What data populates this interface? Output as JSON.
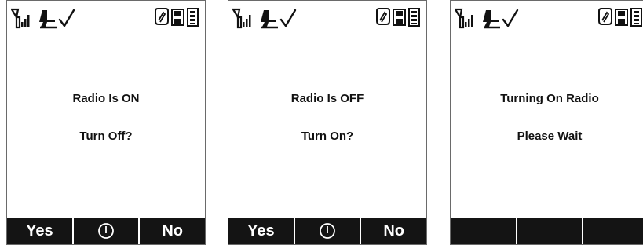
{
  "colors": {
    "softkey_bar": "#141414",
    "softkey_text": "#ffffff",
    "message_text": "#111111",
    "screen_border": "#6a6a6a"
  },
  "status_icons": [
    "signal-strength-icon",
    "airplane-mode-icon",
    "checkmark-icon",
    "message-icon",
    "memory-card-icon",
    "battery-icon"
  ],
  "screens": [
    {
      "message_line_1": "Radio Is ON",
      "message_line_2": "Turn Off?",
      "softkeys": {
        "left": "Yes",
        "center": "power-icon",
        "right": "No"
      }
    },
    {
      "message_line_1": "Radio Is OFF",
      "message_line_2": "Turn On?",
      "softkeys": {
        "left": "Yes",
        "center": "power-icon",
        "right": "No"
      }
    },
    {
      "message_line_1": "Turning On Radio",
      "message_line_2": "Please Wait",
      "softkeys": {
        "left": "",
        "center": "",
        "right": ""
      }
    }
  ]
}
